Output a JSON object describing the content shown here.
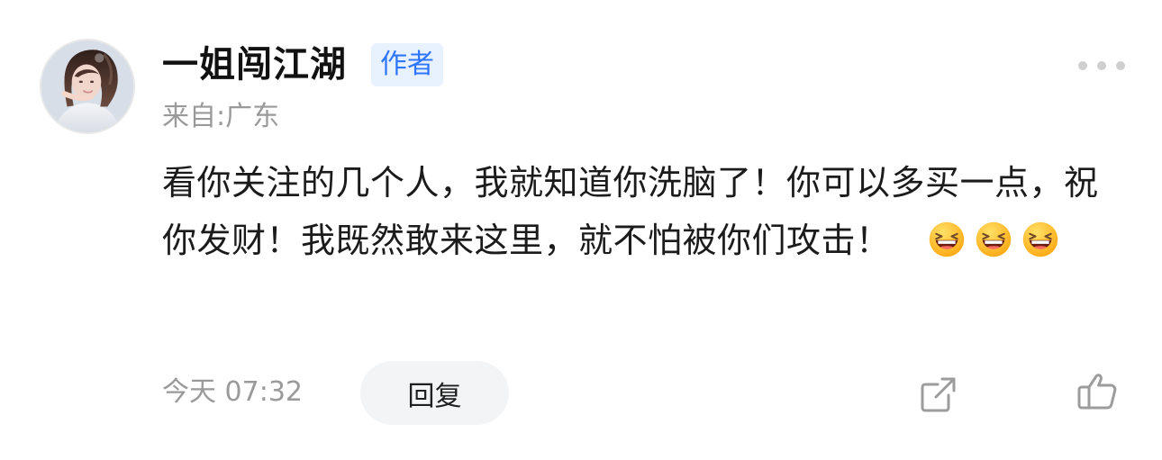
{
  "comment": {
    "username": "一姐闯江湖",
    "badge": "作者",
    "location": "来自:广东",
    "text": "看你关注的几个人，我就知道你洗脑了！你可以多买一点，祝你发财！我既然敢来这里，就不怕被你们攻击！",
    "emoji_count": 3,
    "time": "今天 07:32",
    "reply_label": "回复"
  },
  "icons": {
    "more": "more-dots-icon",
    "share": "share-icon",
    "like": "thumbs-up-icon",
    "emoji": "laughing-emoji-icon"
  },
  "colors": {
    "badge_bg": "#e8f2ff",
    "badge_text": "#2f76ff",
    "muted_text": "#9a9a9a",
    "reply_bg": "#f3f4f5"
  }
}
